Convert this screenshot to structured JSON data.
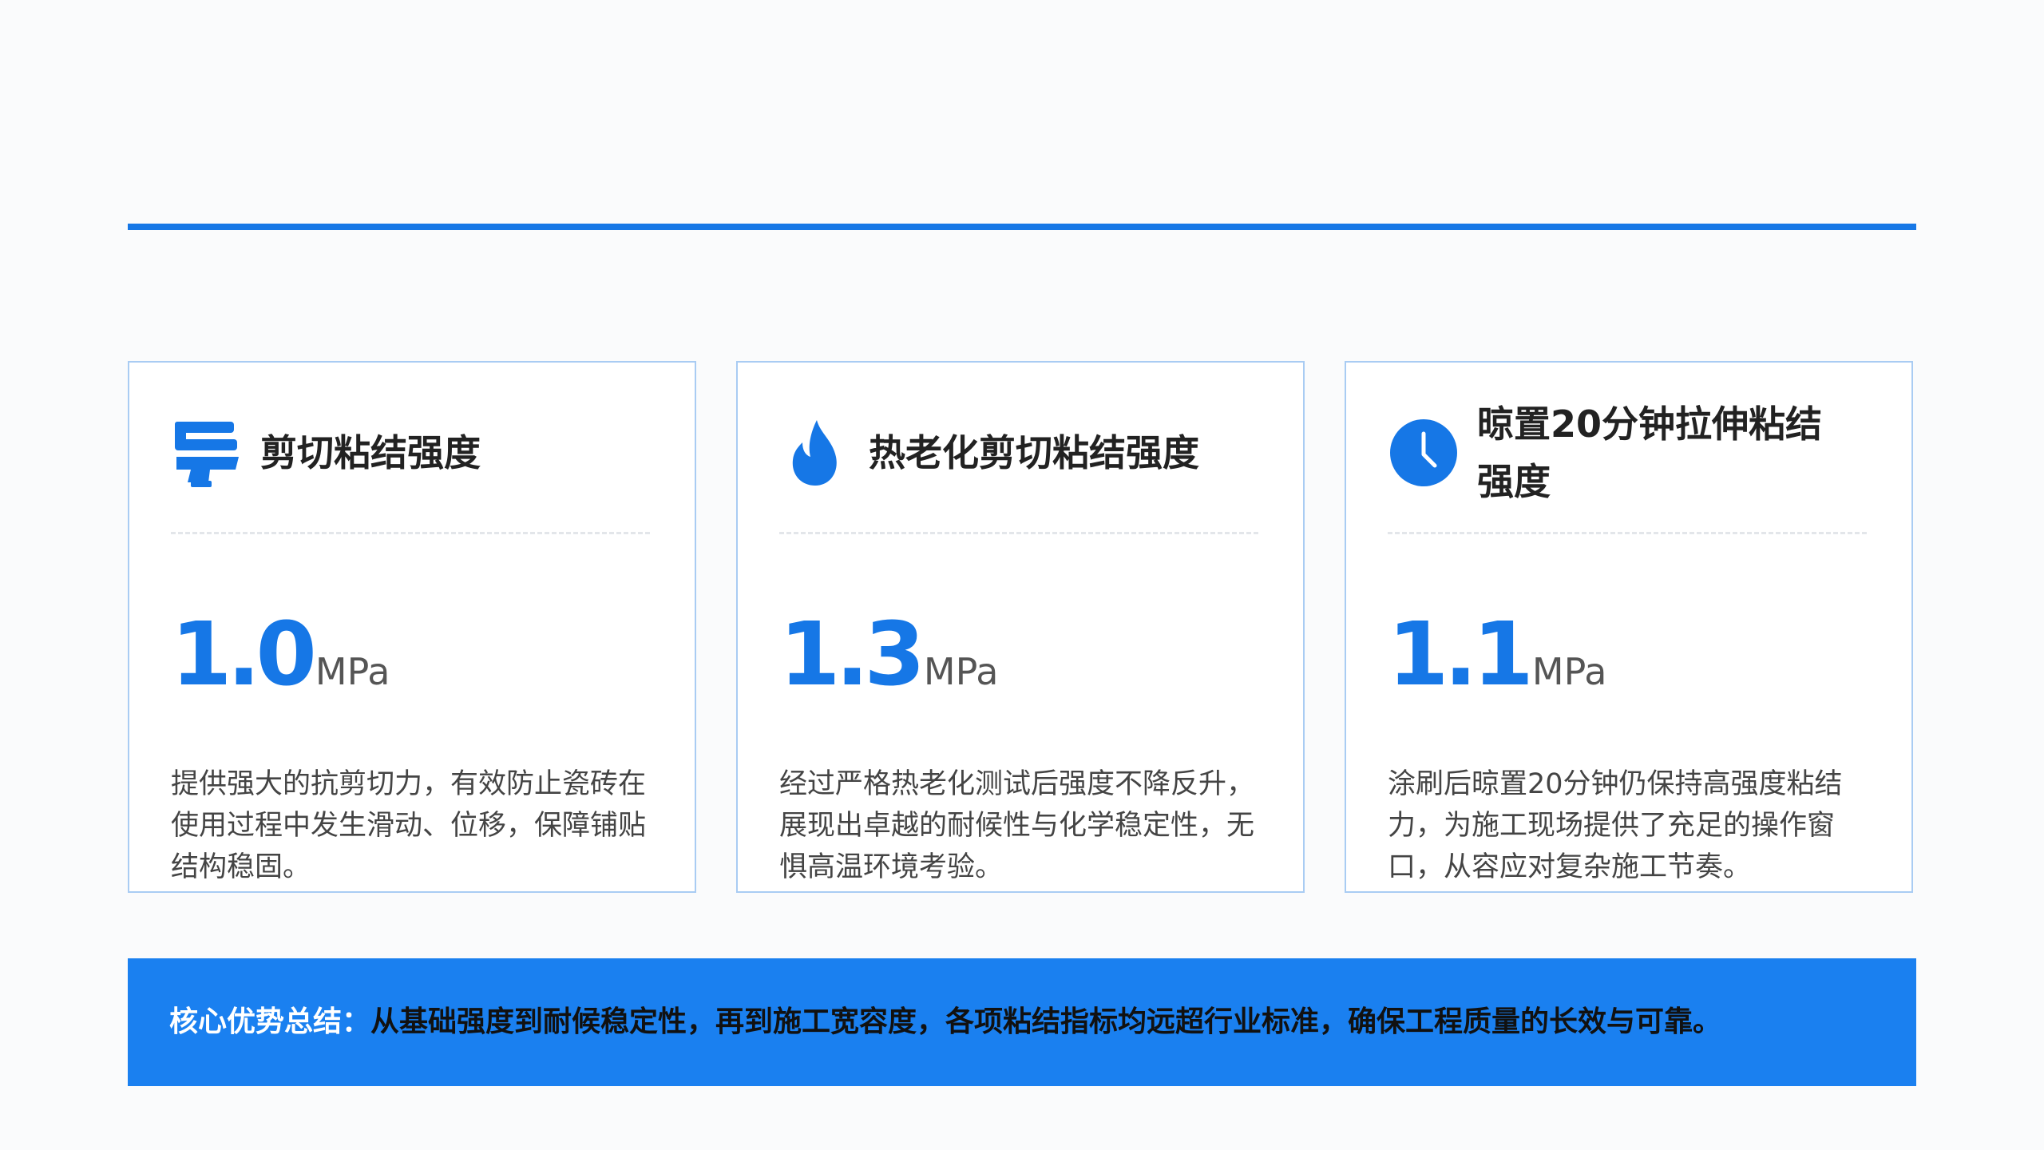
{
  "colors": {
    "accent": "#1677e6",
    "card_border": "#a9ccf3",
    "summary_background": "#1a80f0"
  },
  "cards": [
    {
      "icon": "shear-tool-icon",
      "title": "剪切粘结强度",
      "value": "1.0",
      "unit": "MPa",
      "description": "提供强大的抗剪切力，有效防止瓷砖在使用过程中发生滑动、位移，保障铺贴结构稳固。"
    },
    {
      "icon": "flame-icon",
      "title": "热老化剪切粘结强度",
      "value": "1.3",
      "unit": "MPa",
      "description": "经过严格热老化测试后强度不降反升，展现出卓越的耐候性与化学稳定性，无惧高温环境考验。"
    },
    {
      "icon": "clock-icon",
      "title": "晾置20分钟拉伸粘结强度",
      "value": "1.1",
      "unit": "MPa",
      "description": "涂刷后晾置20分钟仍保持高强度粘结力，为施工现场提供了充足的操作窗口，从容应对复杂施工节奏。"
    }
  ],
  "summary": {
    "label": "核心优势总结：",
    "text": "从基础强度到耐候稳定性，再到施工宽容度，各项粘结指标均远超行业标准，确保工程质量的长效与可靠。"
  }
}
